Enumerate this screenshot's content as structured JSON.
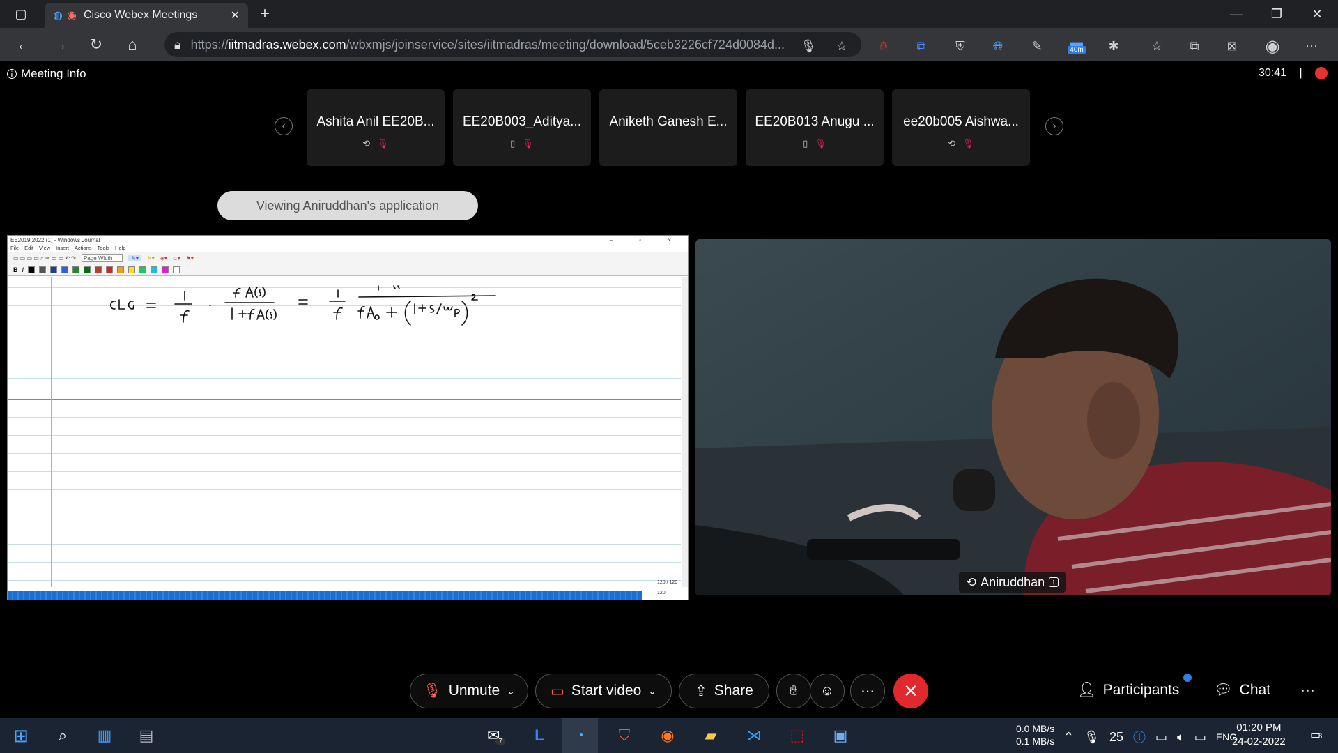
{
  "browser": {
    "tab_title": "Cisco Webex Meetings",
    "url_prefix": "https://",
    "url_host": "iitmadras.webex.com",
    "url_path": "/wbxmjs/joinservice/sites/iitmadras/meeting/download/5ceb3226cf724d0084d...",
    "extension_badge": "40m"
  },
  "meeting": {
    "info_label": "Meeting Info",
    "timer": "30:41",
    "viewing_label": "Viewing Aniruddhan's application",
    "participants": [
      {
        "name": "Ashita Anil EE20B..."
      },
      {
        "name": "EE20B003_Aditya..."
      },
      {
        "name": "Aniketh Ganesh E..."
      },
      {
        "name": "EE20B013 Anugu ..."
      },
      {
        "name": "ee20b005 Aishwa..."
      }
    ],
    "presenter_name": "Aniruddhan"
  },
  "journal": {
    "title": "EE2019 2022 (1) - Windows Journal",
    "menu": [
      "File",
      "Edit",
      "View",
      "Insert",
      "Actions",
      "Tools",
      "Help"
    ],
    "zoom": "Page Width",
    "page_counter": "120 / 120",
    "page_current": "120",
    "colors": [
      "#000000",
      "#555555",
      "#1f3a93",
      "#2f5ee0",
      "#1e8a2a",
      "#0b6b14",
      "#c0392b",
      "#e01e1e",
      "#f39c12",
      "#f7e017",
      "#22c55e",
      "#12c2e0",
      "#e21ecf",
      "#ffffff"
    ]
  },
  "controls": {
    "unmute": "Unmute",
    "start_video": "Start video",
    "share": "Share",
    "participants": "Participants",
    "chat": "Chat"
  },
  "taskbar": {
    "mail_badge": "7",
    "net_up": "0.0 MB/s",
    "net_down": "0.1 MB/s",
    "volume": "25",
    "lang": "ENG",
    "time": "01:20 PM",
    "date": "24-02-2022",
    "notif_count": "3"
  }
}
